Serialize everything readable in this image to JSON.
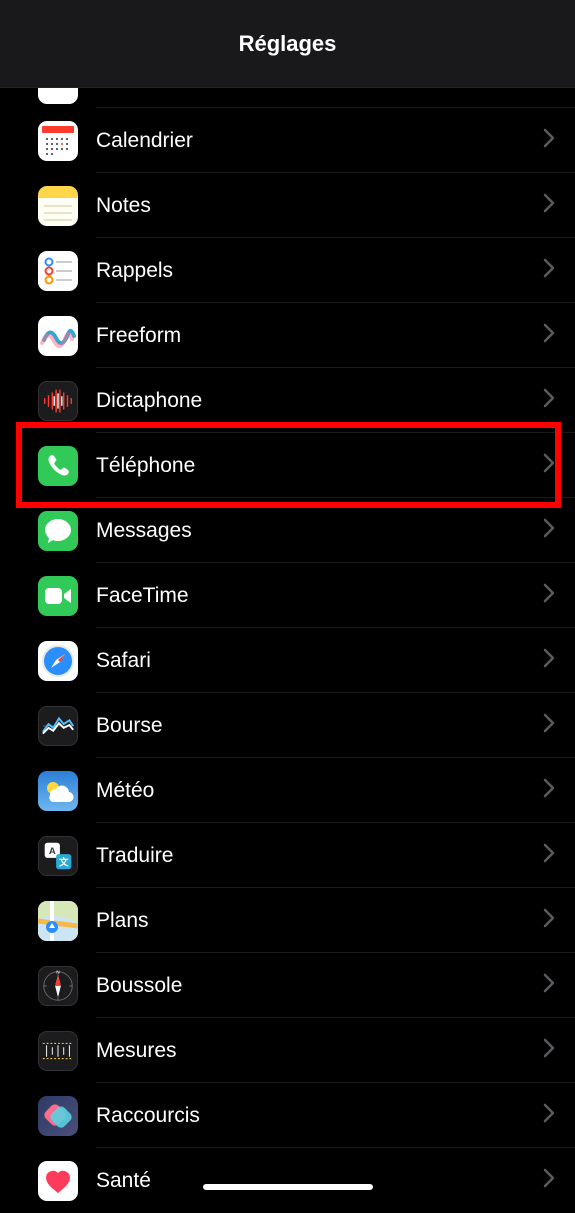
{
  "header": {
    "title": "Réglages"
  },
  "items": [
    {
      "id": "calendar",
      "label": "Calendrier",
      "icon": "calendar-icon"
    },
    {
      "id": "notes",
      "label": "Notes",
      "icon": "notes-icon"
    },
    {
      "id": "reminders",
      "label": "Rappels",
      "icon": "reminders-icon"
    },
    {
      "id": "freeform",
      "label": "Freeform",
      "icon": "freeform-icon"
    },
    {
      "id": "voicememo",
      "label": "Dictaphone",
      "icon": "voice-memo-icon"
    },
    {
      "id": "phone",
      "label": "Téléphone",
      "icon": "phone-icon",
      "highlighted": true
    },
    {
      "id": "messages",
      "label": "Messages",
      "icon": "messages-icon"
    },
    {
      "id": "facetime",
      "label": "FaceTime",
      "icon": "facetime-icon"
    },
    {
      "id": "safari",
      "label": "Safari",
      "icon": "safari-icon"
    },
    {
      "id": "stocks",
      "label": "Bourse",
      "icon": "stocks-icon"
    },
    {
      "id": "weather",
      "label": "Météo",
      "icon": "weather-icon"
    },
    {
      "id": "translate",
      "label": "Traduire",
      "icon": "translate-icon"
    },
    {
      "id": "maps",
      "label": "Plans",
      "icon": "maps-icon"
    },
    {
      "id": "compass",
      "label": "Boussole",
      "icon": "compass-icon"
    },
    {
      "id": "measure",
      "label": "Mesures",
      "icon": "measure-icon"
    },
    {
      "id": "shortcuts",
      "label": "Raccourcis",
      "icon": "shortcuts-icon"
    },
    {
      "id": "health",
      "label": "Santé",
      "icon": "health-icon"
    }
  ],
  "highlight_color": "#ff0000"
}
